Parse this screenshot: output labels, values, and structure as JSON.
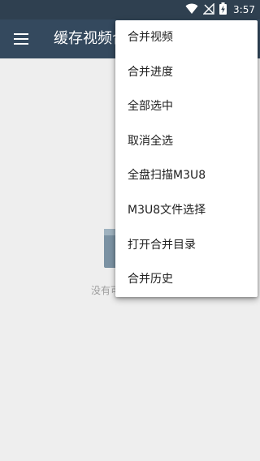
{
  "status_bar": {
    "time": "3:57",
    "icons": [
      "wifi-icon",
      "no-signal-icon",
      "battery-charging-icon"
    ]
  },
  "app_bar": {
    "title": "缓存视频合并",
    "menu_icon": "hamburger-menu-icon"
  },
  "empty_state": {
    "icon": "empty-image-icon",
    "message": "没有可合并的视频"
  },
  "overflow_menu": {
    "items": [
      "合并视频",
      "合并进度",
      "全部选中",
      "取消全选",
      "全盘扫描M3U8",
      "M3U8文件选择",
      "打开合并目录",
      "合并历史"
    ]
  },
  "colors": {
    "status_bar": "#2f4050",
    "app_bar": "#34495e",
    "background": "#eeeeee",
    "menu_background": "#ffffff",
    "menu_text": "#212121",
    "empty_text": "#9e9e9e"
  }
}
